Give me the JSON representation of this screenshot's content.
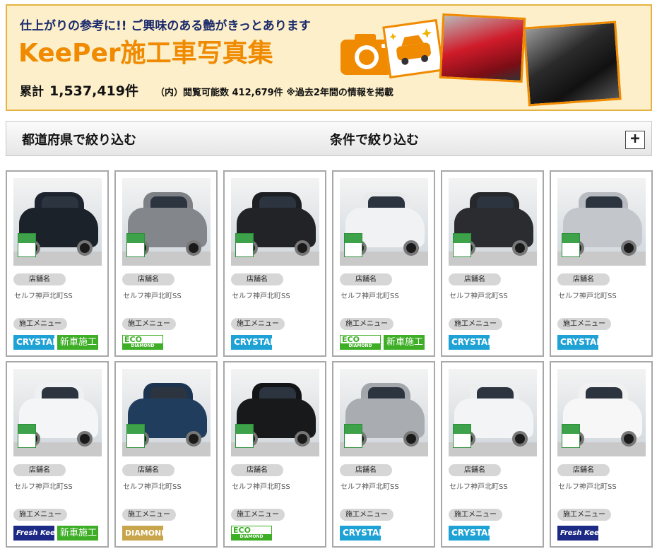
{
  "banner": {
    "subtitle": "仕上がりの参考に!! ご興味のある艶がきっとあります",
    "title": "KeePer施工車写真集",
    "total_label": "累計",
    "total_value": "1,537,419件",
    "viewable": "（内）閲覧可能数 412,679件 ※過去2年間の情報を掲載"
  },
  "filters": {
    "prefecture": "都道府県で絞り込む",
    "conditions": "条件で絞り込む",
    "toggle": "+"
  },
  "cards": [
    {
      "store_label": "店舗名",
      "store": "セルフ神戸北町SS",
      "menu_label": "施工メニュー",
      "badges": [
        "CRYSTAL",
        "新車施工"
      ],
      "color": "#1d2430",
      "body": "#1c2229"
    },
    {
      "store_label": "店舗名",
      "store": "セルフ神戸北町SS",
      "menu_label": "施工メニュー",
      "badges": [
        "ECO DIAMOND"
      ],
      "color": "#7d8084",
      "body": "#83878b"
    },
    {
      "store_label": "店舗名",
      "store": "セルフ神戸北町SS",
      "menu_label": "施工メニュー",
      "badges": [
        "CRYSTAL"
      ],
      "color": "#1e1f22",
      "body": "#222326"
    },
    {
      "store_label": "店舗名",
      "store": "セルフ神戸北町SS",
      "menu_label": "施工メニュー",
      "badges": [
        "ECO DIAMOND",
        "新車施工"
      ],
      "color": "#e9eaec",
      "body": "#f1f2f4"
    },
    {
      "store_label": "店舗名",
      "store": "セルフ神戸北町SS",
      "menu_label": "施工メニュー",
      "badges": [
        "CRYSTAL"
      ],
      "color": "#26282c",
      "body": "#2a2c30"
    },
    {
      "store_label": "店舗名",
      "store": "セルフ神戸北町SS",
      "menu_label": "施工メニュー",
      "badges": [
        "CRYSTAL"
      ],
      "color": "#b8bcc2",
      "body": "#c3c7cc"
    },
    {
      "store_label": "店舗名",
      "store": "セルフ神戸北町SS",
      "menu_label": "施工メニュー",
      "badges": [
        "Fresh KeePer",
        "新車施工"
      ],
      "color": "#eef0f3",
      "body": "#f4f5f7"
    },
    {
      "store_label": "店舗名",
      "store": "セルフ神戸北町SS",
      "menu_label": "施工メニュー",
      "badges": [
        "DIAMOND"
      ],
      "color": "#1c3450",
      "body": "#213d5e"
    },
    {
      "store_label": "店舗名",
      "store": "セルフ神戸北町SS",
      "menu_label": "施工メニュー",
      "badges": [
        "ECO DIAMOND"
      ],
      "color": "#131416",
      "body": "#18191b"
    },
    {
      "store_label": "店舗名",
      "store": "セルフ神戸北町SS",
      "menu_label": "施工メニュー",
      "badges": [
        "CRYSTAL"
      ],
      "color": "#a3a7ac",
      "body": "#a9adb2"
    },
    {
      "store_label": "店舗名",
      "store": "セルフ神戸北町SS",
      "menu_label": "施工メニュー",
      "badges": [
        "CRYSTAL"
      ],
      "color": "#eceef0",
      "body": "#f3f4f6"
    },
    {
      "store_label": "店舗名",
      "store": "セルフ神戸北町SS",
      "menu_label": "施工メニュー",
      "badges": [
        "Fresh KeePer"
      ],
      "color": "#f1f1f1",
      "body": "#f7f7f7"
    }
  ]
}
